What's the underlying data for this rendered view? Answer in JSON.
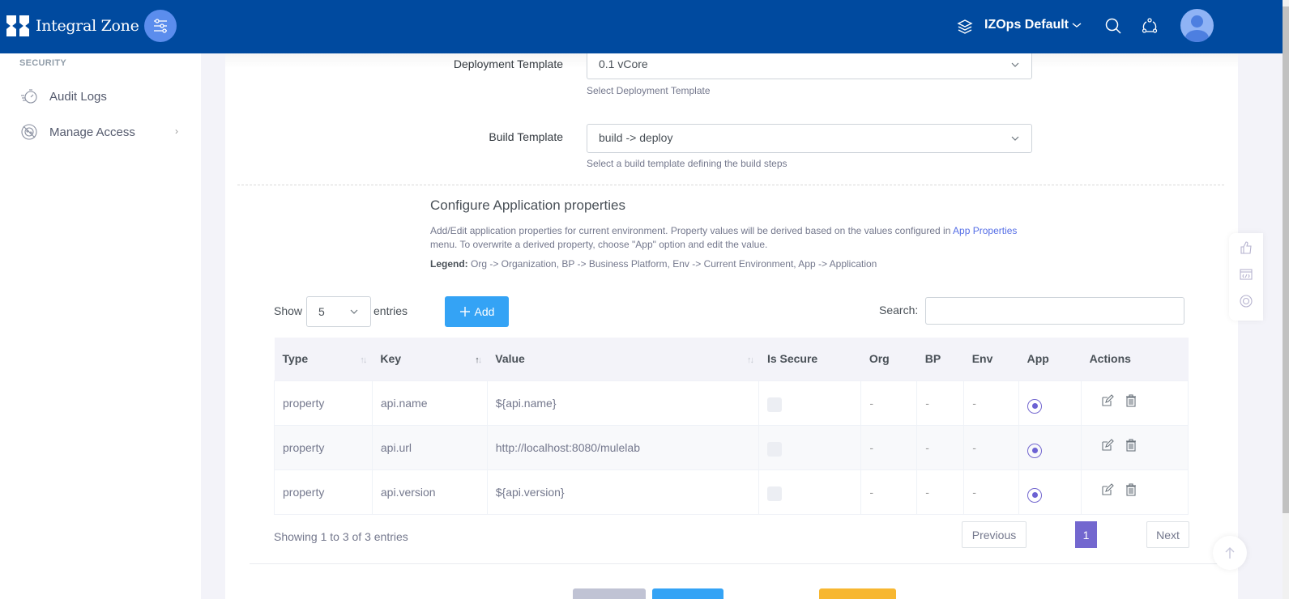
{
  "header": {
    "brand": "Integral Zone",
    "workspace": "IZOps Default",
    "icons": [
      "menu-settings-icon",
      "layers-icon",
      "search-icon",
      "notification-icon",
      "user-avatar"
    ]
  },
  "sidebar": {
    "section_title": "SECURITY",
    "items": [
      {
        "label": "Audit Logs",
        "icon": "stopwatch-icon"
      },
      {
        "label": "Manage Access",
        "icon": "access-icon",
        "has_submenu": true
      }
    ]
  },
  "form": {
    "deployment_template": {
      "label": "Deployment Template",
      "value": "0.1 vCore",
      "help": "Select Deployment Template"
    },
    "build_template": {
      "label": "Build Template",
      "value": "build -> deploy",
      "help": "Select a build template defining the build steps"
    }
  },
  "properties": {
    "title": "Configure Application properties",
    "desc_part1": "Add/Edit application properties for current environment. Property values will be derived based on the values configured in ",
    "desc_link": "App Properties",
    "desc_part2": " menu. To overwrite a derived property, choose \"App\" option and edit the value.",
    "legend_label": "Legend:",
    "legend_text": " Org -> Organization, BP -> Business Platform, Env -> Current Environment, App -> Application"
  },
  "table_controls": {
    "show_label": "Show",
    "page_length": "5",
    "entries_label": "entries",
    "add_label": "Add",
    "search_label": "Search:",
    "search_value": "",
    "search_placeholder": ""
  },
  "table": {
    "columns": [
      "Type",
      "Key",
      "Value",
      "Is Secure",
      "Org",
      "BP",
      "Env",
      "App",
      "Actions"
    ],
    "rows": [
      {
        "type": "property",
        "key": "api.name",
        "value": "${api.name}",
        "is_secure": false,
        "org": "-",
        "bp": "-",
        "env": "-",
        "app_selected": true
      },
      {
        "type": "property",
        "key": "api.url",
        "value": "http://localhost:8080/mulelab",
        "is_secure": false,
        "org": "-",
        "bp": "-",
        "env": "-",
        "app_selected": true
      },
      {
        "type": "property",
        "key": "api.version",
        "value": "${api.version}",
        "is_secure": false,
        "org": "-",
        "bp": "-",
        "env": "-",
        "app_selected": true
      }
    ]
  },
  "pagination": {
    "info": "Showing 1 to 3 of 3 entries",
    "previous": "Previous",
    "current_page": "1",
    "next": "Next"
  },
  "colors": {
    "header_bg": "#004a9f",
    "accent_purple": "#7367cf",
    "add_button": "#34a3f5",
    "link": "#556ee6"
  }
}
